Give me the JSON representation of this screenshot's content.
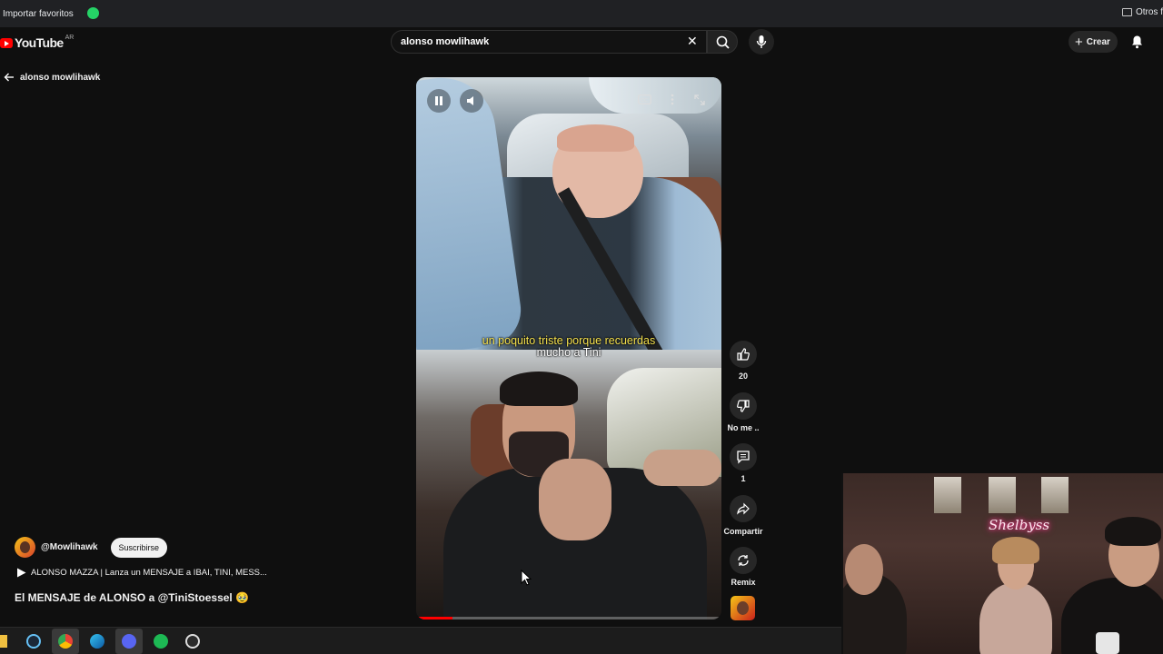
{
  "browser": {
    "bookmarks": {
      "import_label": "Importar favoritos",
      "other_label": "Otros f"
    }
  },
  "header": {
    "logo_text": "YouTube",
    "region": "AR",
    "search_value": "alonso mowlihawk",
    "create_label": "Crear"
  },
  "back": {
    "label": "alonso mowlihawk"
  },
  "video": {
    "subtitle_line1": "un poquito triste porque recuerdas",
    "subtitle_line2": "mucho a Tini",
    "progress": 0.12
  },
  "actions": {
    "like_count": "20",
    "dislike_label": "No me ..",
    "comments_count": "1",
    "share_label": "Compartir",
    "remix_label": "Remix"
  },
  "channel": {
    "handle": "@Mowlihawk",
    "subscribe_label": "Suscribirse"
  },
  "playlist": {
    "label": "ALONSO MAZZA | Lanza un MENSAJE a IBAI, TINI, MESS..."
  },
  "short": {
    "title": "El MENSAJE de ALONSO a @TiniStoessel 🥹"
  },
  "webcam": {
    "neon_sign": "Shelbyss"
  },
  "colors": {
    "background": "#0f0f0f",
    "brand_red": "#ff0000",
    "subtitle_yellow": "#f4e04d"
  }
}
